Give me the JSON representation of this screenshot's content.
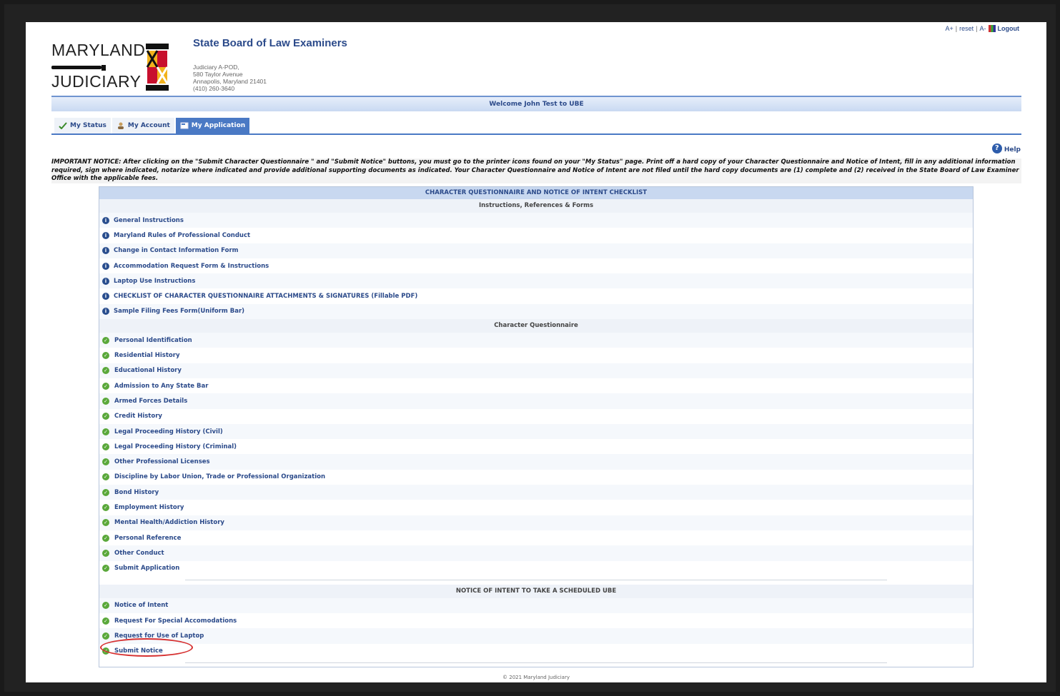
{
  "header": {
    "logo_line1": "MARYLAND",
    "logo_line2": "JUDICIARY",
    "title": "State Board of Law Examiners",
    "address": [
      "Judiciary A-POD,",
      "580 Taylor Avenue",
      "Annapolis, Maryland 21401",
      "(410) 260-3640"
    ],
    "toplinks": {
      "increase": "A+",
      "reset": "reset",
      "decrease": "A-",
      "logout": "Logout"
    }
  },
  "welcome": "Welcome John Test to UBE",
  "tabs": [
    {
      "label": "My Status",
      "icon": "status-icon",
      "active": false
    },
    {
      "label": "My Account",
      "icon": "account-icon",
      "active": false
    },
    {
      "label": "My Application",
      "icon": "application-icon",
      "active": true
    }
  ],
  "help_label": "Help",
  "notice": "IMPORTANT NOTICE: After clicking on the \"Submit Character Questionnaire \" and \"Submit Notice\" buttons, you must go to the printer icons found on your \"My Status\" page. Print off a hard copy of your Character Questionnaire and Notice of Intent, fill in any additional information required, sign where indicated, notarize where indicated and provide additional supporting documents as indicated. Your Character Questionnaire and Notice of Intent are not filed until the hard copy documents are (1) complete and (2) received in the State Board of Law Examiner Office with the applicable fees.",
  "checklist": {
    "title": "CHARACTER QUESTIONNAIRE AND NOTICE OF INTENT CHECKLIST",
    "sections": {
      "instructions": {
        "heading": "Instructions, References & Forms",
        "items": [
          "General Instructions",
          "Maryland Rules of Professional Conduct",
          "Change in Contact Information Form",
          "Accommodation Request Form & Instructions",
          "Laptop Use Instructions",
          "CHECKLIST OF CHARACTER QUESTIONNAIRE ATTACHMENTS & SIGNATURES (Fillable PDF)",
          "Sample Filing Fees Form(Uniform Bar)"
        ]
      },
      "questionnaire": {
        "heading": "Character Questionnaire",
        "items": [
          "Personal Identification",
          "Residential History",
          "Educational History",
          "Admission to Any State Bar",
          "Armed Forces Details",
          "Credit History",
          "Legal Proceeding History (Civil)",
          "Legal Proceeding History (Criminal)",
          "Other Professional Licenses",
          "Discipline by Labor Union, Trade or Professional Organization",
          "Bond History",
          "Employment History",
          "Mental Health/Addiction History",
          "Personal Reference",
          "Other Conduct",
          "Submit Application"
        ]
      },
      "notice_of_intent": {
        "heading": "NOTICE OF INTENT TO TAKE A SCHEDULED UBE",
        "items": [
          "Notice of Intent",
          "Request For Special Accomodations",
          "Request for Use of Laptop",
          "Submit Notice"
        ]
      }
    }
  },
  "footer": "© 2021 Maryland Judiciary",
  "colors": {
    "accent": "#2b4a8a",
    "tab_active": "#4a79c4",
    "check": "#5aa83a",
    "highlight_circle": "#d63030"
  }
}
